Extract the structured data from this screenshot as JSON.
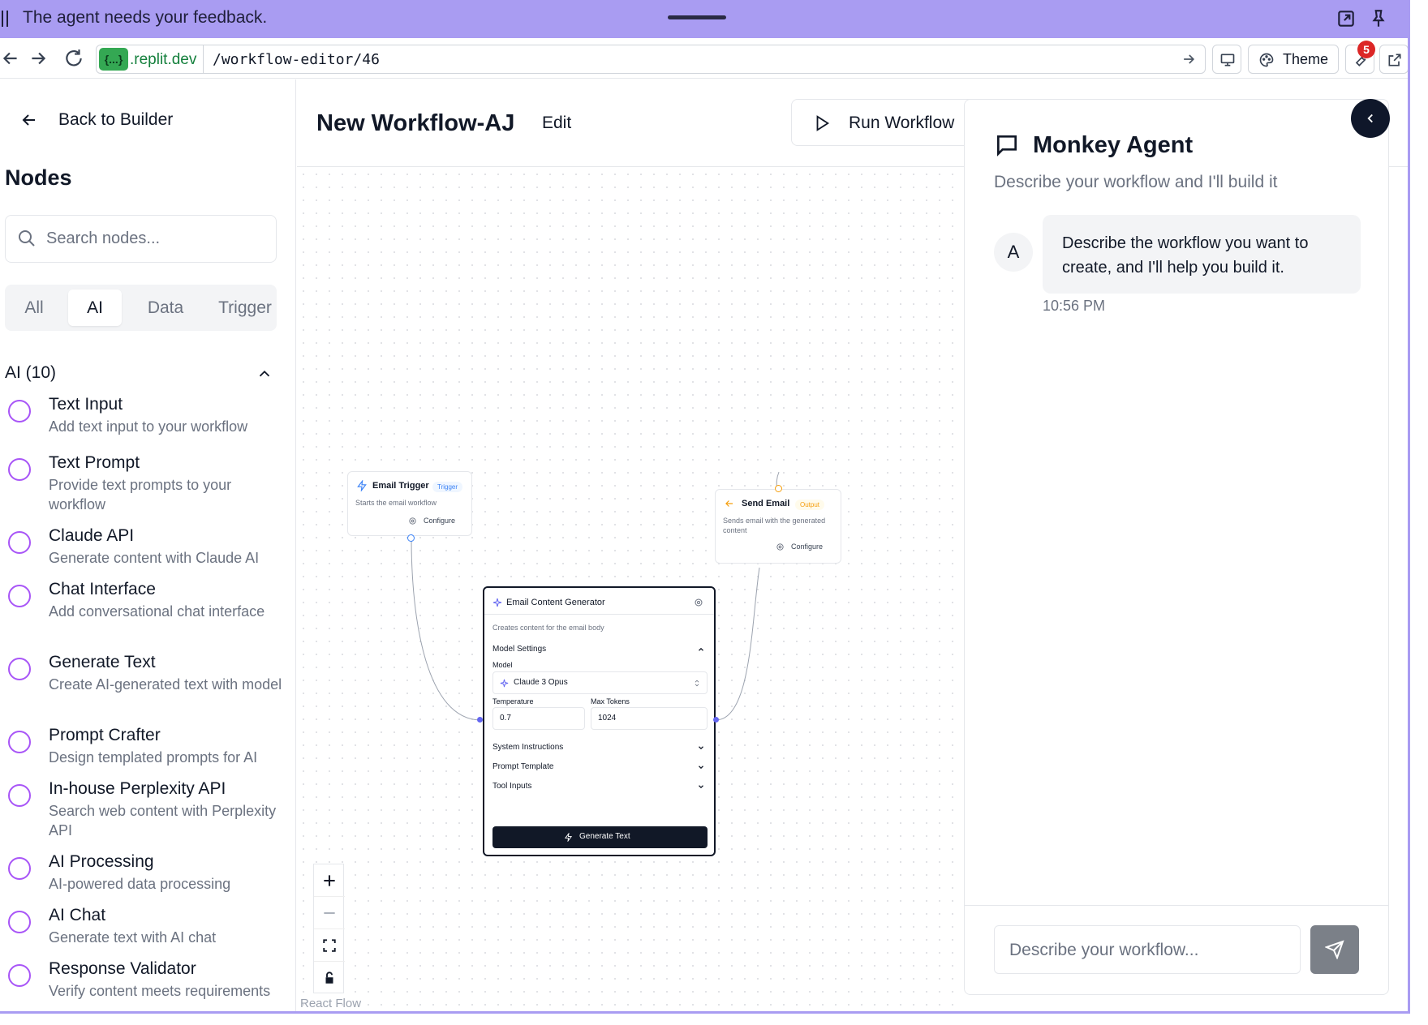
{
  "banner": {
    "message": "The agent needs your feedback."
  },
  "browser": {
    "domain_chip": "{...}",
    "domain": ".replit.dev",
    "path": "/workflow-editor/46",
    "theme_label": "Theme",
    "notification_count": "5"
  },
  "sidebar": {
    "back_label": "Back to Builder",
    "title": "Nodes",
    "search_placeholder": "Search nodes...",
    "tabs": [
      {
        "label": "All"
      },
      {
        "label": "AI"
      },
      {
        "label": "Data"
      },
      {
        "label": "Trigger"
      }
    ],
    "active_tab": "AI",
    "section_title": "AI (10)",
    "items": [
      {
        "name": "Text Input",
        "desc": "Add text input to your workflow"
      },
      {
        "name": "Text Prompt",
        "desc": "Provide text prompts to your workflow"
      },
      {
        "name": "Claude API",
        "desc": "Generate content with Claude AI"
      },
      {
        "name": "Chat Interface",
        "desc": "Add conversational chat interface"
      },
      {
        "name": "Generate Text",
        "desc": "Create AI-generated text with model"
      },
      {
        "name": "Prompt Crafter",
        "desc": "Design templated prompts for AI"
      },
      {
        "name": "In-house Perplexity API",
        "desc": "Search web content with Perplexity API"
      },
      {
        "name": "AI Processing",
        "desc": "AI-powered data processing"
      },
      {
        "name": "AI Chat",
        "desc": "Generate text with AI chat"
      },
      {
        "name": "Response Validator",
        "desc": "Verify content meets requirements"
      }
    ]
  },
  "editor": {
    "title": "New Workflow-AJ",
    "edit_label": "Edit",
    "run_label": "Run Workflow"
  },
  "canvas": {
    "email_trigger": {
      "title": "Email Trigger",
      "tag": "Trigger",
      "desc": "Starts the email workflow",
      "configure": "Configure"
    },
    "send_email": {
      "title": "Send Email",
      "tag": "Output",
      "desc": "Sends email with the generated content",
      "configure": "Configure"
    },
    "generator": {
      "title": "Email Content Generator",
      "desc": "Creates content for the email body",
      "model_settings": "Model Settings",
      "model_label": "Model",
      "model_value": "Claude 3 Opus",
      "temperature_label": "Temperature",
      "temperature_value": "0.7",
      "max_tokens_label": "Max Tokens",
      "max_tokens_value": "1024",
      "system_instructions": "System Instructions",
      "prompt_template": "Prompt Template",
      "tool_inputs": "Tool Inputs",
      "generate_label": "Generate Text"
    },
    "attribution": "React Flow"
  },
  "chat": {
    "title": "Monkey Agent",
    "subtitle": "Describe your workflow and I'll build it",
    "avatar": "A",
    "message": "Describe the workflow you want to create, and I'll help you build it.",
    "time": "10:56 PM",
    "input_placeholder": "Describe your workflow..."
  },
  "colors": {
    "banner": "#a99cf2",
    "node_ring": "#a855f7",
    "trigger_accent": "#3b82f6",
    "output_accent": "#f59e0b",
    "generator_accent": "#6366f1"
  }
}
